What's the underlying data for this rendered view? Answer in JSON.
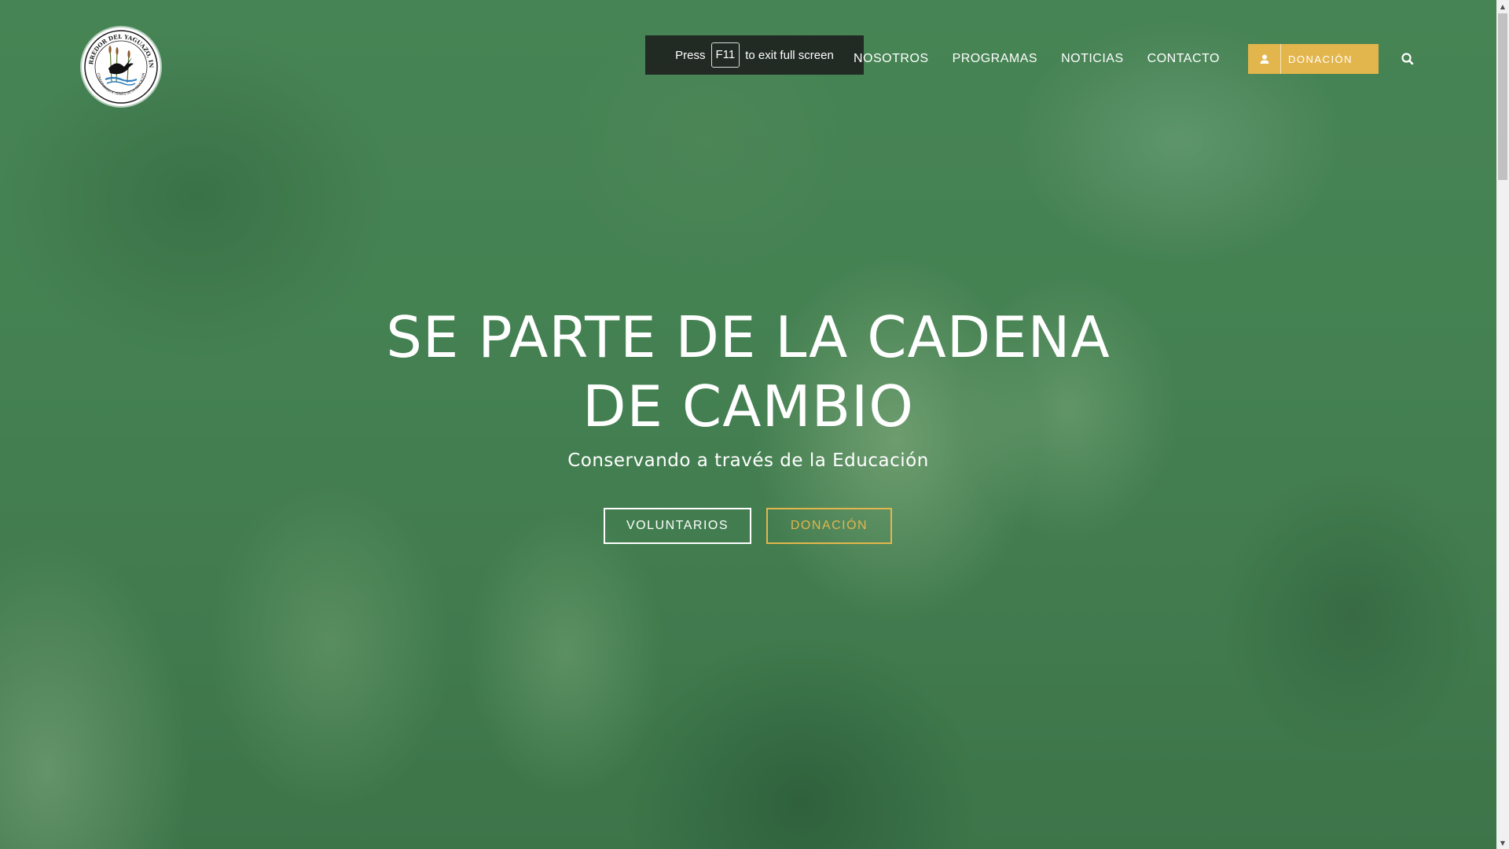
{
  "browser": {
    "fullscreen_toast": {
      "press_label": "Press",
      "key_label": "F11",
      "suffix_label": "to exit full screen"
    }
  },
  "header": {
    "logo": {
      "top_text": "CORREDOR DEL YAGUAZO, INC.",
      "bottom_text": "CONSERVANDO A TRAVÉS DE LA EDUCACIÓN",
      "icon": "heron-logo-icon"
    },
    "nav": {
      "items": [
        {
          "label": "NOSOTROS"
        },
        {
          "label": "PROGRAMAS"
        },
        {
          "label": "NOTICIAS"
        },
        {
          "label": "CONTACTO"
        }
      ]
    },
    "donate_button": {
      "label": "DONACIÓN",
      "icon": "user-icon"
    },
    "search_icon": "search-icon"
  },
  "hero": {
    "title_line1": "SE PARTE DE LA CADENA",
    "title_line2": "DE CAMBIO",
    "subtitle": "Conservando a través de la Educación",
    "buttons": {
      "volunteer": "VOLUNTARIOS",
      "donate": "DONACIÓN"
    }
  },
  "colors": {
    "accent_gold": "#e3b64d",
    "overlay_green": "#3f7a4e",
    "text_white": "#ffffff"
  }
}
